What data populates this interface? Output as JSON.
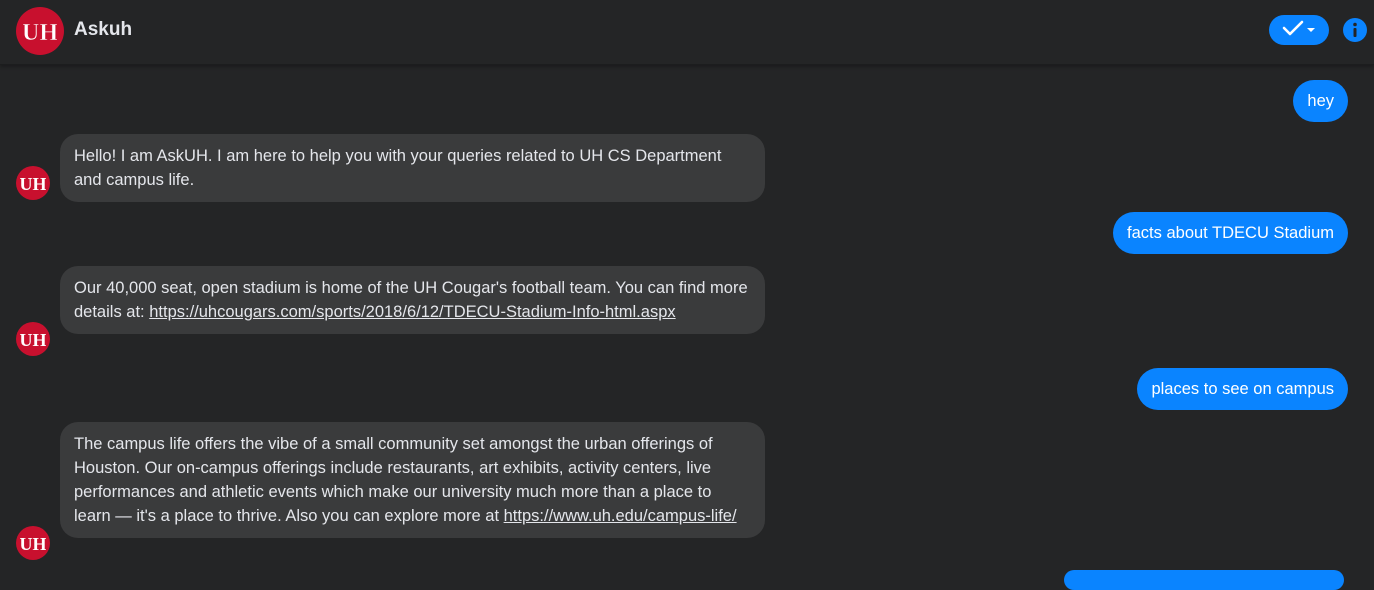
{
  "header": {
    "bot_name": "Askuh",
    "logo_icon": "uh-logo-icon",
    "logo_text": "UH",
    "actions": [
      {
        "icon": "check-dropdown-icon"
      },
      {
        "icon": "info-icon"
      }
    ]
  },
  "colors": {
    "background": "#242526",
    "bot_bubble": "#3a3b3c",
    "user_bubble": "#0a84ff",
    "brand_red": "#c8102e"
  },
  "messages": [
    {
      "sender": "user",
      "text": "hey"
    },
    {
      "sender": "bot",
      "text": "Hello! I am AskUH. I am here to help you with your queries related to UH CS Department and campus life."
    },
    {
      "sender": "user",
      "text": "facts about TDECU Stadium"
    },
    {
      "sender": "bot",
      "text_before": "Our 40,000 seat, open stadium is home of the UH Cougar's football team. You can find more details at: ",
      "link": "https://uhcougars.com/sports/2018/6/12/TDECU-Stadium-Info-html.aspx"
    },
    {
      "sender": "user",
      "text": "places to see on campus"
    },
    {
      "sender": "bot",
      "text_before": "The campus life offers the vibe of a small community set amongst the urban offerings of Houston. Our on-campus offerings include restaurants, art exhibits, activity centers, live performances and athletic events which make our university much more than a place to learn — it's a place to thrive. Also you can explore more at ",
      "link": "https://www.uh.edu/campus-life/"
    }
  ]
}
